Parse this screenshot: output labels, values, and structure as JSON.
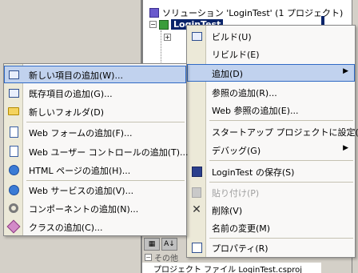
{
  "explorer": {
    "solution_label": "ソリューション 'LoginTest' (1 プロジェクト)",
    "project_label": "LoginTest"
  },
  "props": {
    "category": "その他",
    "row": "プロジェクト ファイル   LoginTest.csproj"
  },
  "context_menu": {
    "items": [
      {
        "label": "ビルド(U)",
        "icon": "build-icon"
      },
      {
        "label": "リビルド(E)",
        "icon": ""
      },
      {
        "label": "追加(D)",
        "icon": "",
        "submenu": true
      },
      {
        "label": "参照の追加(R)...",
        "icon": ""
      },
      {
        "label": "Web 参照の追加(E)...",
        "icon": ""
      },
      {
        "label": "スタートアップ プロジェクトに設定(A)",
        "icon": ""
      },
      {
        "label": "デバッグ(G)",
        "icon": "",
        "submenu": true
      },
      {
        "label": "LoginTest の保存(S)",
        "icon": "save-icon"
      },
      {
        "label": "貼り付け(P)",
        "icon": "paste-icon",
        "disabled": true
      },
      {
        "label": "削除(V)",
        "icon": "delete-icon"
      },
      {
        "label": "名前の変更(M)",
        "icon": ""
      },
      {
        "label": "プロパティ(R)",
        "icon": "properties-icon"
      }
    ]
  },
  "add_submenu": {
    "items": [
      {
        "label": "新しい項目の追加(W)...",
        "icon": "new-item-icon"
      },
      {
        "label": "既存項目の追加(G)...",
        "icon": "existing-item-icon"
      },
      {
        "label": "新しいフォルダ(D)",
        "icon": "folder-icon"
      },
      {
        "label": "Web フォームの追加(F)...",
        "icon": "web-form-icon"
      },
      {
        "label": "Web ユーザー コントロールの追加(T)...",
        "icon": "user-control-icon"
      },
      {
        "label": "HTML ページの追加(H)...",
        "icon": "html-page-icon"
      },
      {
        "label": "Web サービスの追加(V)...",
        "icon": "web-service-icon"
      },
      {
        "label": "コンポーネントの追加(N)...",
        "icon": "component-icon"
      },
      {
        "label": "クラスの追加(C)...",
        "icon": "class-icon"
      }
    ]
  },
  "colors": {
    "highlight": "#c1d2ee",
    "highlight_border": "#316ac5",
    "gutter": "#ece9d8",
    "selection": "#0a246a"
  }
}
